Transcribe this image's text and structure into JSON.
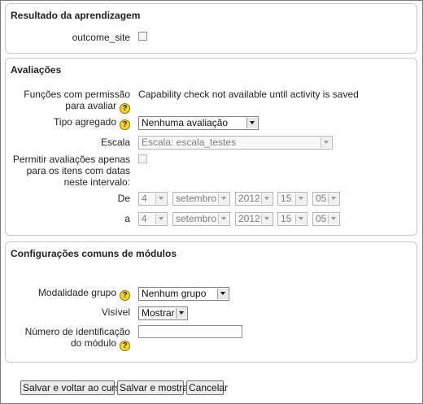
{
  "outcomes": {
    "legend": "Resultado da aprendizagem",
    "outcome_label": "outcome_site",
    "outcome_checked": false
  },
  "ratings": {
    "legend": "Avaliações",
    "permissions_label": "Funções com permissão para avaliar",
    "permissions_text": "Capability check not available until activity is saved",
    "aggregate_label": "Tipo agregado",
    "aggregate_value": "Nenhuma avaliação",
    "scale_label": "Escala",
    "scale_value": "Escala: escala_testes",
    "time_restrict_label": "Permitir avaliações apenas para os itens com datas neste intervalo:",
    "time_restrict_checked": false,
    "from_label": "De",
    "to_label": "a",
    "from": {
      "day": "4",
      "month": "setembro",
      "year": "2012",
      "hour": "15",
      "minute": "05"
    },
    "to": {
      "day": "4",
      "month": "setembro",
      "year": "2012",
      "hour": "15",
      "minute": "05"
    }
  },
  "common": {
    "legend": "Configurações comuns de módulos",
    "group_mode_label": "Modalidade grupo",
    "group_mode_value": "Nenhum grupo",
    "visible_label": "Visível",
    "visible_value": "Mostrar",
    "idnumber_label": "Número de identificação do módulo",
    "idnumber_value": ""
  },
  "buttons": {
    "save_return": "Salvar e voltar ao curso",
    "save_display": "Salvar e mostrar",
    "cancel": "Cancelar"
  },
  "icons": {
    "help": "help-icon"
  },
  "colors": {
    "help_icon": "#f7d51d",
    "fieldset_border": "#c8c8c8"
  }
}
